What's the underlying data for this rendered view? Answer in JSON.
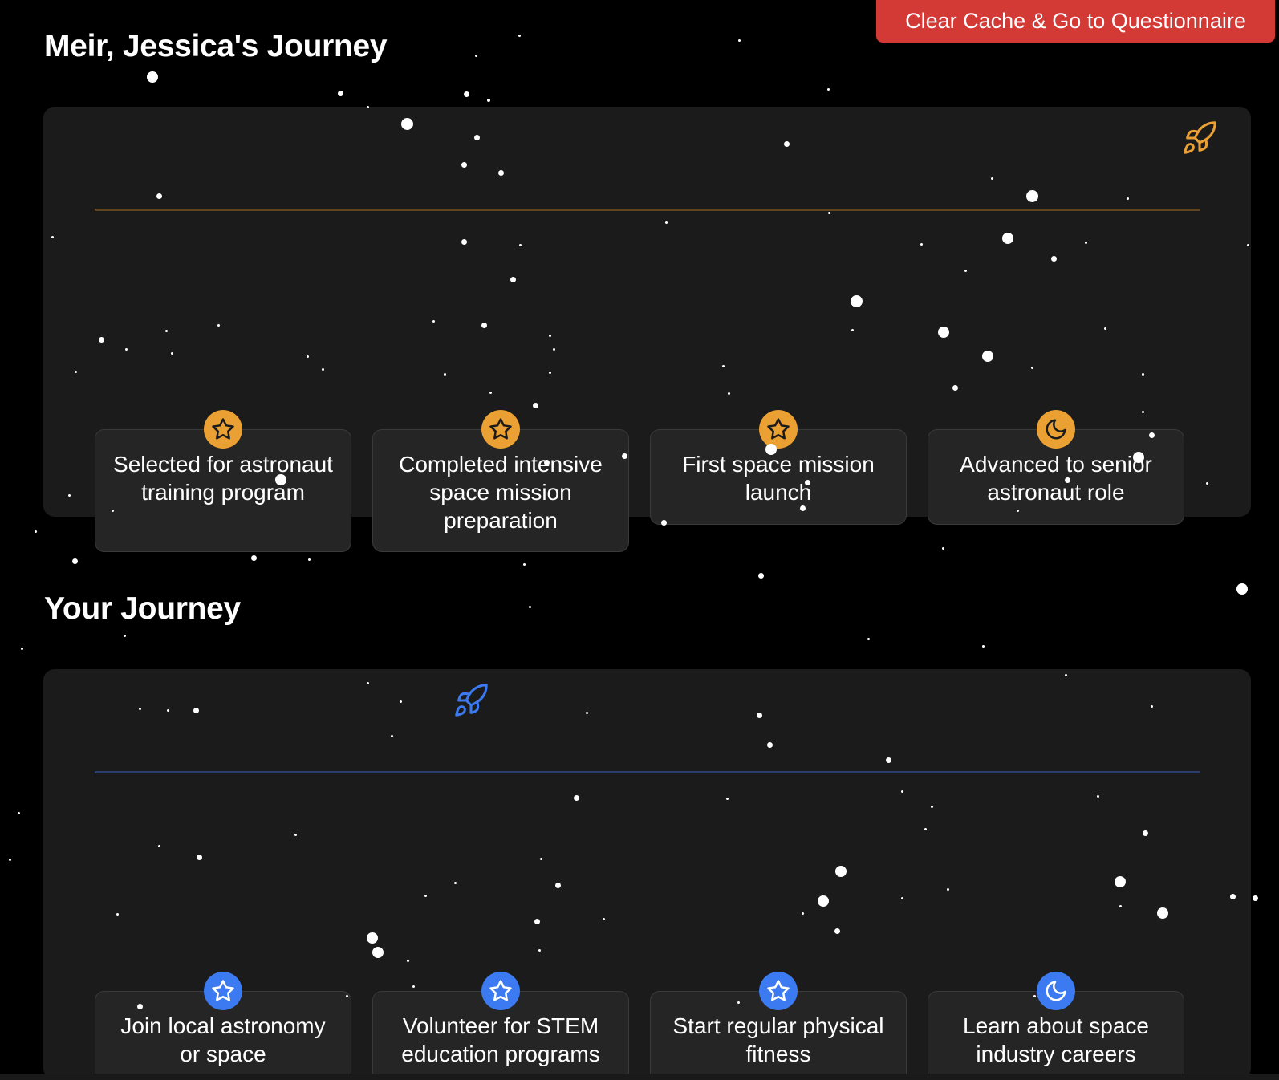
{
  "toolbar": {
    "clear_label": "Clear Cache & Go to Questionnaire",
    "clear_color": "#d33a36"
  },
  "sections": [
    {
      "title": "Meir, Jessica's Journey",
      "accent": "#eba033",
      "line_color": "#5e4520",
      "rocket_icon": "rocket-icon",
      "milestones": [
        {
          "label": "Selected for astronaut training program",
          "icon": "star-icon"
        },
        {
          "label": "Completed intensive space mission preparation",
          "icon": "star-icon"
        },
        {
          "label": "First space mission launch",
          "icon": "star-icon"
        },
        {
          "label": "Advanced to senior astronaut role",
          "icon": "moon-icon"
        }
      ]
    },
    {
      "title": "Your Journey",
      "accent": "#3b7af0",
      "line_color": "#2c3e6e",
      "rocket_icon": "rocket-icon",
      "milestones": [
        {
          "label": "Join local astronomy or space",
          "icon": "star-icon"
        },
        {
          "label": "Volunteer for STEM education programs",
          "icon": "star-icon"
        },
        {
          "label": "Start regular physical fitness",
          "icon": "star-icon"
        },
        {
          "label": "Learn about space industry careers",
          "icon": "moon-icon"
        }
      ]
    }
  ]
}
